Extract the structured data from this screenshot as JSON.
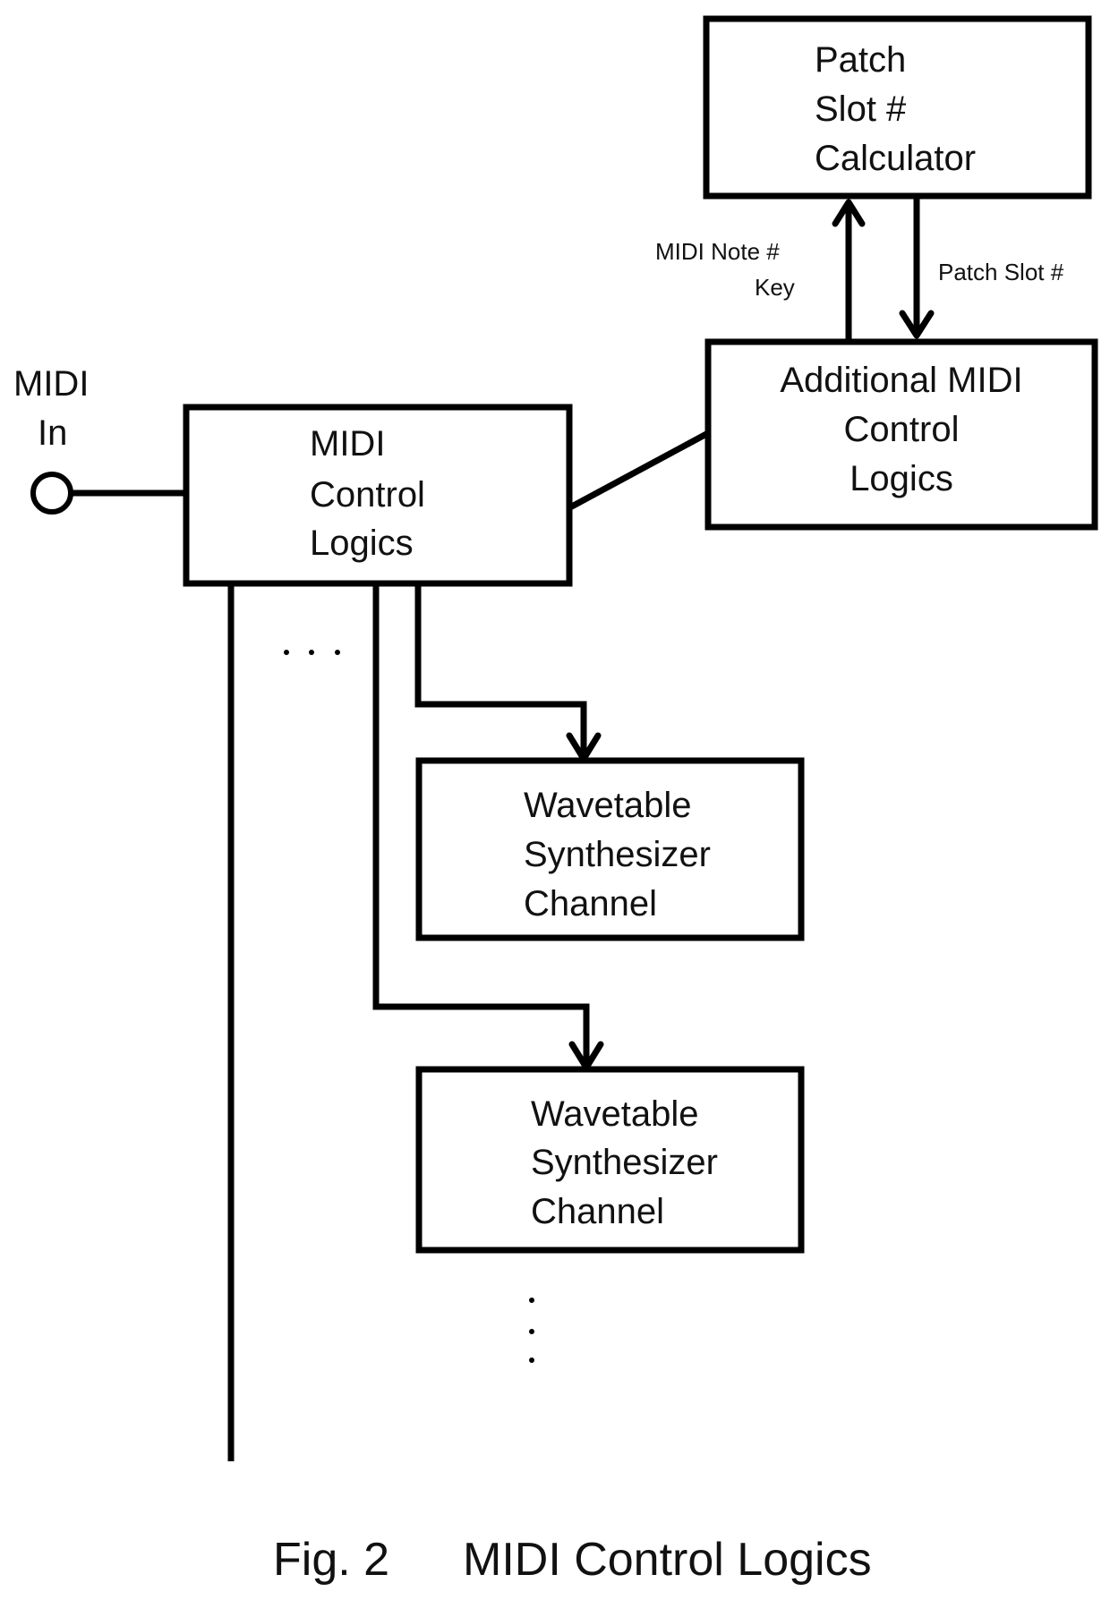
{
  "figure": {
    "number_label": "Fig. 2",
    "title": "MIDI Control Logics"
  },
  "input": {
    "label_lines": [
      "MIDI",
      "In"
    ]
  },
  "blocks": {
    "patch_calculator": {
      "lines": [
        "Patch",
        "Slot #",
        "Calculator"
      ]
    },
    "additional_logics": {
      "lines": [
        "Additional MIDI",
        "Control",
        "Logics"
      ]
    },
    "midi_control": {
      "lines": [
        "MIDI",
        "Control",
        "Logics"
      ]
    },
    "synth_channel_1": {
      "lines": [
        "Wavetable",
        "Synthesizer",
        "Channel"
      ]
    },
    "synth_channel_2": {
      "lines": [
        "Wavetable",
        "Synthesizer",
        "Channel"
      ]
    }
  },
  "edges": {
    "note_to_calculator": {
      "lines": [
        "MIDI Note #",
        "Key"
      ]
    },
    "calculator_to_additional": {
      "lines": [
        "Patch Slot #"
      ]
    }
  },
  "ellipsis": {
    "horizontal": "...",
    "vertical": "..."
  }
}
